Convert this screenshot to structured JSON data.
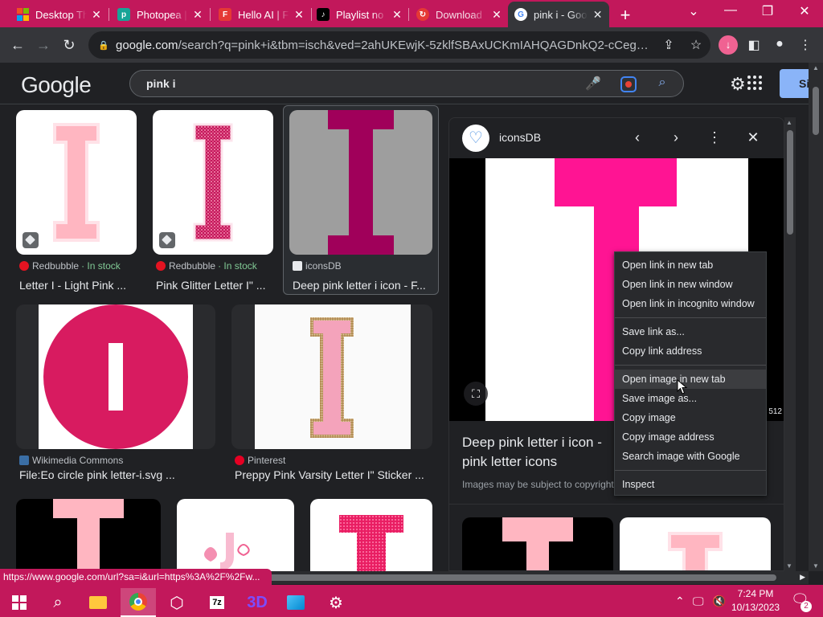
{
  "tabs": [
    {
      "label": "Desktop Th",
      "icon": "microsoft-icon",
      "color": "#f25022"
    },
    {
      "label": "Photopea |",
      "icon": "photopea-icon",
      "color": "#18a497"
    },
    {
      "label": "Hello AI | F",
      "icon": "f-logo-icon",
      "color": "#e53935"
    },
    {
      "label": "Playlist no",
      "icon": "tiktok-icon",
      "color": "#000000"
    },
    {
      "label": "Download",
      "icon": "download-site-icon",
      "color": "#e53935"
    },
    {
      "label": "pink i - Goo",
      "icon": "google-icon",
      "color": "#ffffff"
    }
  ],
  "address": {
    "host": "google.com",
    "path": "/search?q=pink+i&tbm=isch&ved=2ahUKEwjK-5zklfSBAxUCKmIAHQAGDnkQ2-cCegQIABAA&..."
  },
  "google": {
    "logo": "Google",
    "query": "pink i",
    "signin": "Si"
  },
  "results": [
    {
      "source": "Redbubble",
      "stock": "· In stock",
      "title": "Letter I - Light Pink ...",
      "fav_color": "#e41321"
    },
    {
      "source": "Redbubble",
      "stock": "· In stock",
      "title": "Pink Glitter Letter I\" ...",
      "fav_color": "#e41321"
    },
    {
      "source": "iconsDB",
      "stock": "",
      "title": "Deep pink letter i icon - F...",
      "fav_color": "#4a90e2"
    },
    {
      "source": "Wikimedia Commons",
      "stock": "",
      "title": "File:Eo circle pink letter-i.svg ...",
      "fav_color": "#3a6ea5"
    },
    {
      "source": "Pinterest",
      "stock": "",
      "title": "Preppy Pink Varsity Letter I\" Sticker ...",
      "fav_color": "#e60023"
    }
  ],
  "panel": {
    "source": "iconsDB",
    "title": "Deep pink letter i icon - pink letter icons",
    "note": "Images may be subject to copyright",
    "dimension": "512"
  },
  "context_menu": {
    "items": [
      "Open link in new tab",
      "Open link in new window",
      "Open link in incognito window",
      "Save link as...",
      "Copy link address",
      "Open image in new tab",
      "Save image as...",
      "Copy image",
      "Copy image address",
      "Search image with Google",
      "Inspect"
    ]
  },
  "status_url": "https://www.google.com/url?sa=i&url=https%3A%2F%2Fw...",
  "clock": {
    "time": "7:24 PM",
    "date": "10/13/2023"
  },
  "notifications": "2",
  "colors": {
    "accent": "#c2185b",
    "deep_pink": "#ff1493",
    "light_pink": "#ffb6c1",
    "dark_magenta": "#a0005a"
  }
}
